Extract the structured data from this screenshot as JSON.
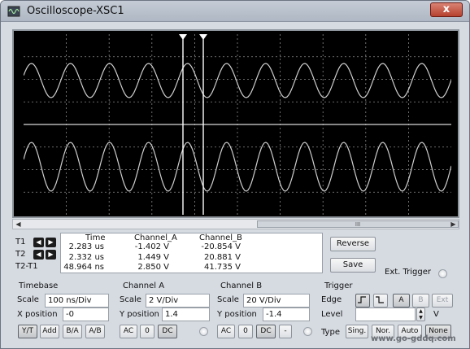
{
  "window": {
    "title": "Oscilloscope-XSC1",
    "close_label": "x"
  },
  "screen": {
    "background": "#000000",
    "trace_color": "#cfcfcf",
    "grid_color": "#8a8a8a",
    "cursor_color": "#ffffff"
  },
  "cursors": {
    "t1_label": "T1",
    "t2_label": "T2",
    "diff_label": "T2-T1"
  },
  "readout": {
    "headers": [
      "Time",
      "Channel_A",
      "Channel_B"
    ],
    "rows": [
      {
        "label": "T1",
        "time": "2.283 us",
        "a": "-1.402 V",
        "b": "-20.854 V"
      },
      {
        "label": "T2",
        "time": "2.332 us",
        "a": "1.449 V",
        "b": "20.881 V"
      },
      {
        "label": "T2-T1",
        "time": "48.964 ns",
        "a": "2.850 V",
        "b": "41.735 V"
      }
    ]
  },
  "buttons": {
    "reverse": "Reverse",
    "save": "Save",
    "ext_trigger": "Ext. Trigger"
  },
  "timebase": {
    "title": "Timebase",
    "scale_label": "Scale",
    "scale_value": "100 ns/Div",
    "xpos_label": "X position",
    "xpos_value": "-0",
    "modes": [
      "Y/T",
      "Add",
      "B/A",
      "A/B"
    ]
  },
  "channel_a": {
    "title": "Channel A",
    "scale_label": "Scale",
    "scale_value": "2  V/Div",
    "ypos_label": "Y position",
    "ypos_value": "1.4",
    "coupling": [
      "AC",
      "0",
      "DC"
    ]
  },
  "channel_b": {
    "title": "Channel B",
    "scale_label": "Scale",
    "scale_value": "20  V/Div",
    "ypos_label": "Y position",
    "ypos_value": "-1.4",
    "coupling": [
      "AC",
      "0",
      "DC",
      "-"
    ]
  },
  "trigger": {
    "title": "Trigger",
    "edge_label": "Edge",
    "sources": [
      "A",
      "B",
      "Ext"
    ],
    "level_label": "Level",
    "level_value": "",
    "level_unit": "V",
    "type_label": "Type",
    "types": [
      "Sing.",
      "Nor.",
      "Auto",
      "None"
    ]
  },
  "watermark": "www.go-gddq.com",
  "scroll_thumb": "III"
}
